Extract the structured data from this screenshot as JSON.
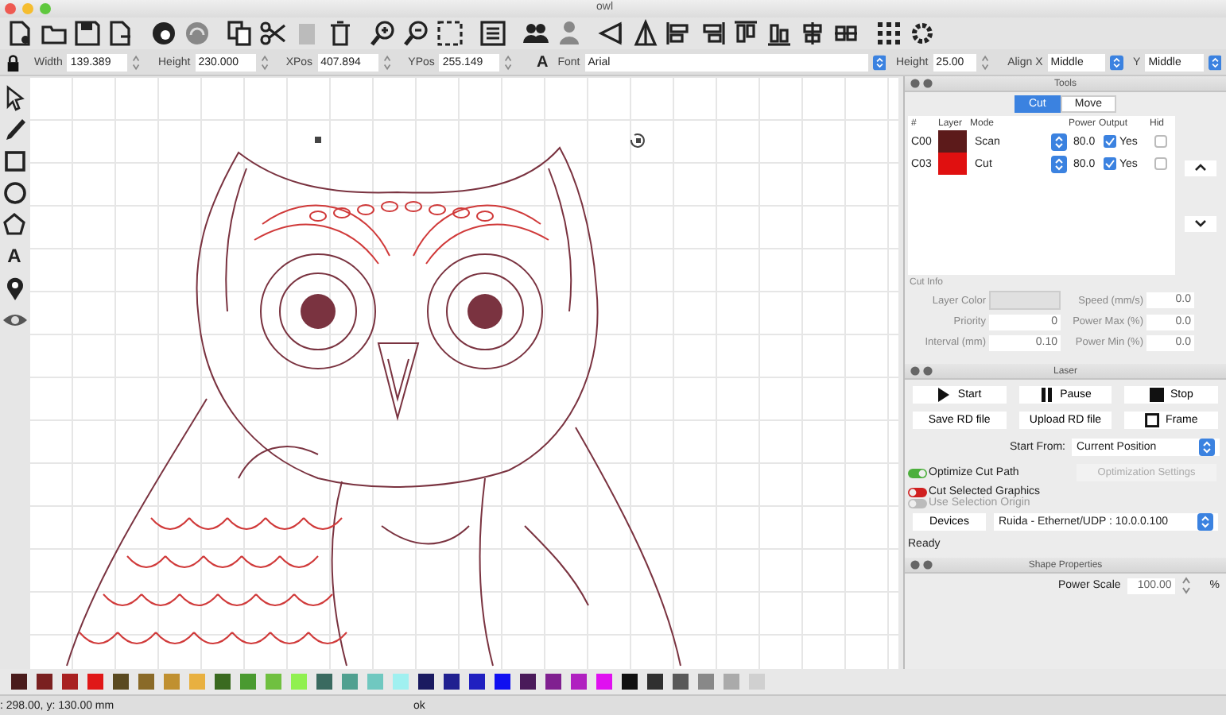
{
  "window": {
    "title": "owl"
  },
  "property_bar": {
    "fields": [
      {
        "label": "Width",
        "value": "139.389"
      },
      {
        "label": "Height",
        "value": "230.000"
      },
      {
        "label": "XPos",
        "value": "407.894"
      },
      {
        "label": "YPos",
        "value": "255.149"
      }
    ],
    "text_tool_glyph": "A",
    "font": {
      "label": "Font",
      "value": "Arial"
    },
    "text_height": {
      "label": "Height",
      "value": "25.00"
    },
    "align_x": {
      "label": "Align X",
      "value": "Middle"
    },
    "align_y": {
      "label": "Y",
      "value": "Middle"
    }
  },
  "left_tools": {
    "text_tool_glyph": "A"
  },
  "tools_panel": {
    "title": "Tools",
    "tabs": [
      {
        "label": "Cut",
        "selected": true
      },
      {
        "label": "Move",
        "selected": false
      }
    ],
    "columns": [
      "#",
      "Layer",
      "Mode",
      "Power",
      "Output",
      "Hid"
    ],
    "layers": [
      {
        "number": "C00",
        "color": "#5c1a1a",
        "mode": "Scan",
        "power": "80.0",
        "output": true,
        "output_label": "Yes",
        "hidden": false
      },
      {
        "number": "C03",
        "color": "#e01010",
        "mode": "Cut",
        "power": "80.0",
        "output": true,
        "output_label": "Yes",
        "hidden": false
      }
    ],
    "cut_info": {
      "title": "Cut Info",
      "layer_color_label": "Layer Color",
      "fields": [
        {
          "label": "Speed (mm/s)",
          "value": "0.0"
        },
        {
          "label": "Priority",
          "value": "0"
        },
        {
          "label": "Power Max (%)",
          "value": "0.0"
        },
        {
          "label": "Interval (mm)",
          "value": "0.10"
        },
        {
          "label": "Power Min (%)",
          "value": "0.0"
        }
      ]
    }
  },
  "laser_panel": {
    "title": "Laser",
    "buttons": [
      {
        "label": "Start",
        "kind": "play"
      },
      {
        "label": "Pause",
        "kind": "pause"
      },
      {
        "label": "Stop",
        "kind": "stop"
      },
      {
        "label": "Save RD file",
        "kind": "plain"
      },
      {
        "label": "Upload RD file",
        "kind": "plain"
      },
      {
        "label": "Frame",
        "kind": "frame"
      }
    ],
    "start_from": {
      "label": "Start From:",
      "value": "Current Position"
    },
    "optimize": {
      "label": "Optimize Cut Path",
      "on": true
    },
    "optimization_settings": {
      "label": "Optimization Settings",
      "disabled": true
    },
    "options": [
      {
        "label": "Cut Selected Graphics",
        "on": false,
        "disabled": false
      },
      {
        "label": "Use Selection Origin",
        "on": false,
        "disabled": true
      }
    ],
    "devices_button": "Devices",
    "device": "Ruida - Ethernet/UDP : 10.0.0.100",
    "status": "Ready"
  },
  "shape_properties": {
    "title": "Shape Properties",
    "power_scale": {
      "label": "Power Scale",
      "value": "100.00",
      "unit": "%"
    }
  },
  "palette": [
    {
      "color": "#4a1c1c"
    },
    {
      "color": "#7a2020"
    },
    {
      "color": "#a82020"
    },
    {
      "color": "#e01818"
    },
    {
      "color": "#5a4a20"
    },
    {
      "color": "#8a6a28"
    },
    {
      "color": "#c09030"
    },
    {
      "color": "#e8b040"
    },
    {
      "color": "#3a6a20"
    },
    {
      "color": "#4a9a30"
    },
    {
      "color": "#70c040"
    },
    {
      "color": "#90f050"
    },
    {
      "color": "#3a6a60"
    },
    {
      "color": "#50a090"
    },
    {
      "color": "#70c8c0"
    },
    {
      "color": "#a0f0f0"
    },
    {
      "color": "#1a1a60"
    },
    {
      "color": "#202090"
    },
    {
      "color": "#2020c0"
    },
    {
      "color": "#1010f0"
    },
    {
      "color": "#4a1a5a"
    },
    {
      "color": "#802090"
    },
    {
      "color": "#b020c0"
    },
    {
      "color": "#e010f0"
    },
    {
      "color": "#101010"
    },
    {
      "color": "#303030"
    },
    {
      "color": "#585858"
    },
    {
      "color": "#888888"
    },
    {
      "color": "#aaaaaa"
    },
    {
      "color": "#d0d0d0"
    }
  ],
  "status_bar": {
    "position": ": 298.00, y: 130.00 mm",
    "message": "ok"
  }
}
